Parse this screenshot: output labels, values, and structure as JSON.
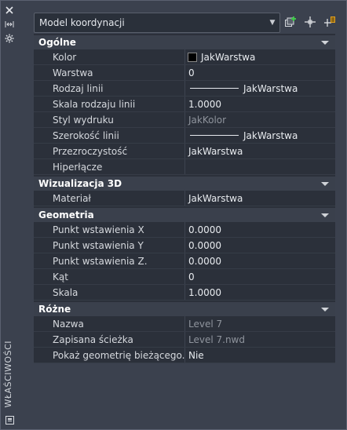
{
  "window": {
    "vertical_title": "WŁAŚCIWOŚCI"
  },
  "top": {
    "selector_value": "Model koordynacji"
  },
  "sections": {
    "ogolne": {
      "title": "Ogólne"
    },
    "wiz3d": {
      "title": "Wizualizacja 3D"
    },
    "geometria": {
      "title": "Geometria"
    },
    "rozne": {
      "title": "Różne"
    }
  },
  "rows": {
    "kolor": {
      "name": "Kolor",
      "value": "JakWarstwa"
    },
    "warstwa": {
      "name": "Warstwa",
      "value": "0"
    },
    "rodzaj_linii": {
      "name": "Rodzaj linii",
      "value": "JakWarstwa"
    },
    "skala_rodzaju_linii": {
      "name": "Skala rodzaju linii",
      "value": "1.0000"
    },
    "styl_wydruku": {
      "name": "Styl wydruku",
      "value": "JakKolor"
    },
    "szerokosc_linii": {
      "name": "Szerokość linii",
      "value": "JakWarstwa"
    },
    "przezroczystosc": {
      "name": "Przezroczystość",
      "value": "JakWarstwa"
    },
    "hiperlacze": {
      "name": "Hiperłącze",
      "value": ""
    },
    "material": {
      "name": "Materiał",
      "value": "JakWarstwa"
    },
    "pkt_x": {
      "name": "Punkt wstawienia X",
      "value": "0.0000"
    },
    "pkt_y": {
      "name": "Punkt wstawienia Y",
      "value": "0.0000"
    },
    "pkt_z": {
      "name": "Punkt wstawienia Z.",
      "value": "0.0000"
    },
    "kat": {
      "name": "Kąt",
      "value": "0"
    },
    "skala": {
      "name": "Skala",
      "value": "1.0000"
    },
    "nazwa": {
      "name": "Nazwa",
      "value": "Level 7"
    },
    "sciezka": {
      "name": "Zapisana ścieżka",
      "value": "Level 7.nwd"
    },
    "pokaz": {
      "name": "Pokaż geometrię bieżącego...",
      "value": "Nie"
    }
  }
}
